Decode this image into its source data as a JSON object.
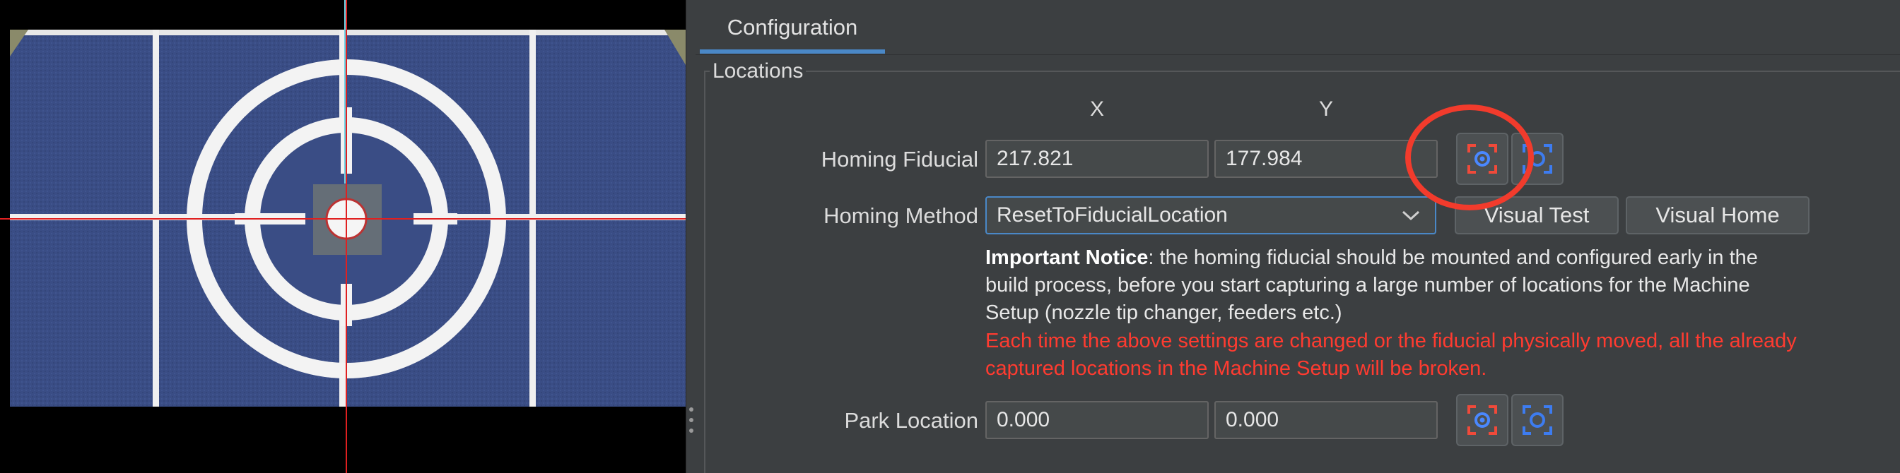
{
  "tab": {
    "label": "Configuration"
  },
  "group": {
    "title": "Locations"
  },
  "columns": {
    "x": "X",
    "y": "Y"
  },
  "homing_fiducial": {
    "label": "Homing Fiducial",
    "x": "217.821",
    "y": "177.984"
  },
  "homing_method": {
    "label": "Homing Method",
    "selected": "ResetToFiducialLocation",
    "visual_test_label": "Visual Test",
    "visual_home_label": "Visual Home"
  },
  "notice": {
    "bold": "Important Notice",
    "text": ": the homing fiducial should be mounted and configured early in the build process, before you start capturing a large number of locations for the Machine Setup (nozzle tip changer, feeders etc.)",
    "warning": "Each time the above settings are changed or the fiducial physically moved, all the already captured locations in the Machine Setup will be broken."
  },
  "park_location": {
    "label": "Park Location",
    "x": "0.000",
    "y": "0.000"
  },
  "icons": {
    "capture_camera": "capture-camera-location-icon",
    "position_camera": "position-camera-icon",
    "dropdown": "chevron-down-icon"
  },
  "colors": {
    "accent": "#4a88c7",
    "warning": "#ff3b30",
    "highlight": "#f23b2c",
    "crosshair_red": "#e02020",
    "crosshair_cyan": "#6fd6e8",
    "fiducial_blue": "#3a4f86"
  }
}
